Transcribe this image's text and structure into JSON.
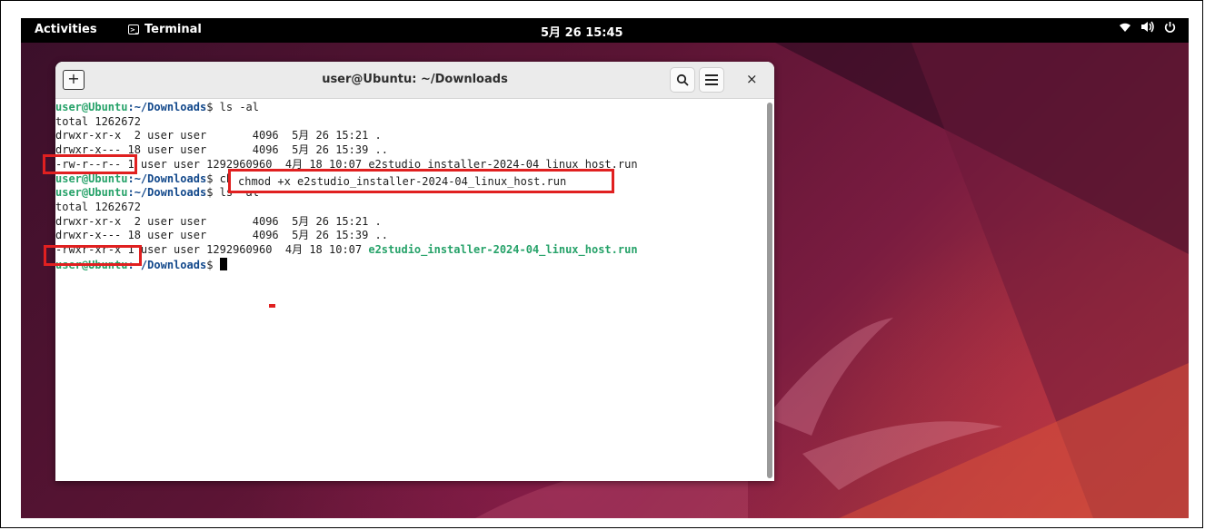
{
  "topbar": {
    "activities": "Activities",
    "app_label": "Terminal",
    "clock": "5月 26 15:45",
    "status_icons": [
      "wifi-icon",
      "volume-icon",
      "power-icon"
    ]
  },
  "window": {
    "title": "user@Ubuntu: ~/Downloads",
    "new_tab_icon": "new-tab-icon",
    "search_icon": "search-icon",
    "menu_icon": "hamburger-menu-icon",
    "close_label": "×"
  },
  "terminal": {
    "prompt_user": "user@Ubuntu",
    "prompt_path": ":~/Downloads",
    "prompt_symbol": "$ ",
    "cmd1": "ls -al",
    "total1": "total 1262672",
    "l1_row1": "drwxr-xr-x  2 user user       4096  5月 26 15:21 .",
    "l1_row2": "drwxr-x--- 18 user user       4096  5月 26 15:39 ..",
    "l1_row3_perm": "-rw-r--r--",
    "l1_row3_rest": " 1 user user 1292960960  4月 18 10:07 e2studio_installer-2024-04_linux_host.run",
    "cmd2": "chmod +x e2studio_installer-2024-04_linux_host.run",
    "cmd3": "ls -al",
    "total2": "total 1262672",
    "l2_row1": "drwxr-xr-x  2 user user       4096  5月 26 15:21 .",
    "l2_row2": "drwxr-x--- 18 user user       4096  5月 26 15:39 ..",
    "l2_row3_perm": "-rwxr-xr-x",
    "l2_row3_meta": " 1 user user 1292960960  4月 18 10:07 ",
    "l2_row3_file": "e2studio_installer-2024-04_linux_host.run"
  },
  "colors": {
    "highlight": "#e02020",
    "prompt_user": "#26a269",
    "prompt_path": "#12488b"
  }
}
